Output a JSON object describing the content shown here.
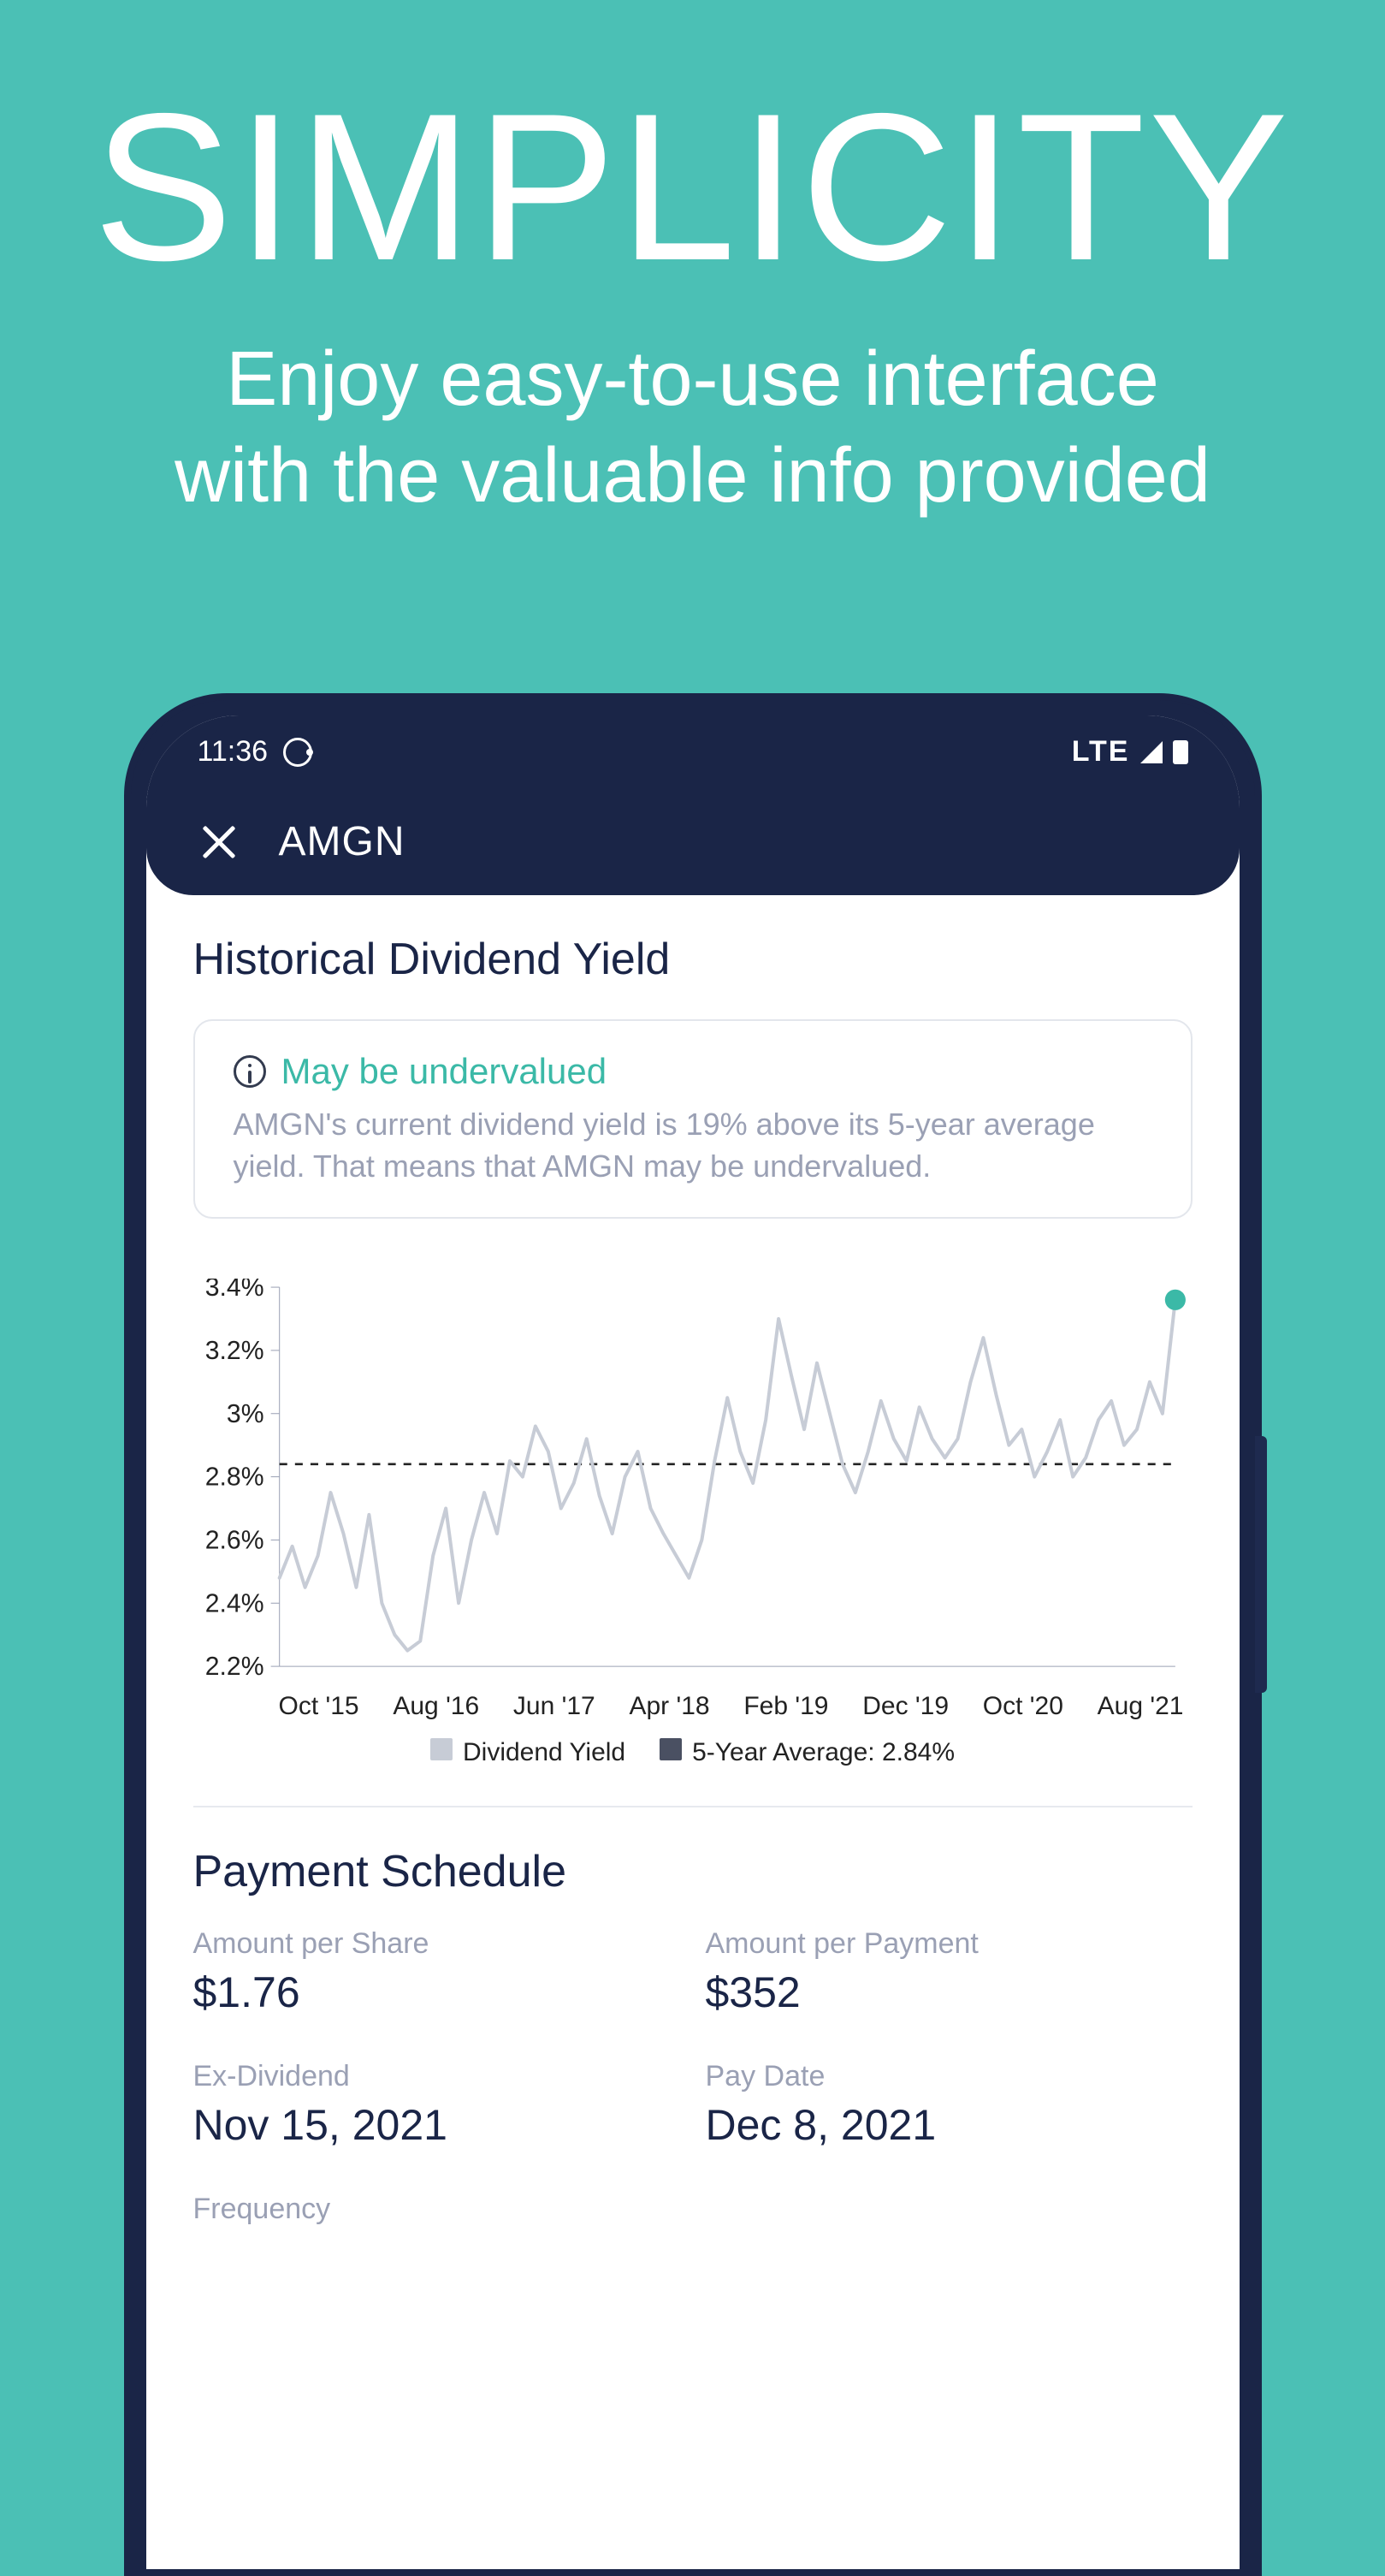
{
  "hero": {
    "title": "SIMPLICITY",
    "subtitle_line1": "Enjoy easy-to-use interface",
    "subtitle_line2": "with the valuable info provided"
  },
  "statusbar": {
    "time": "11:36",
    "net": "LTE"
  },
  "appbar": {
    "ticker": "AMGN"
  },
  "section": {
    "title": "Historical Dividend Yield",
    "info_headline": "May be undervalued",
    "info_body": "AMGN's current dividend yield is 19% above its 5-year average yield. That means that AMGN may be undervalued."
  },
  "legend": {
    "series_label": "Dividend Yield",
    "avg_label": "5-Year Average: 2.84%"
  },
  "payment": {
    "heading": "Payment Schedule",
    "items": [
      {
        "label": "Amount per Share",
        "value": "$1.76"
      },
      {
        "label": "Amount per Payment",
        "value": "$352"
      },
      {
        "label": "Ex-Dividend",
        "value": "Nov 15, 2021"
      },
      {
        "label": "Pay Date",
        "value": "Dec 8, 2021"
      },
      {
        "label": "Frequency",
        "value": ""
      }
    ]
  },
  "chart_data": {
    "type": "line",
    "title": "Historical Dividend Yield",
    "ylabel": "",
    "ylim": [
      2.2,
      3.4
    ],
    "yticks": [
      "3.4%",
      "3.2%",
      "3%",
      "2.8%",
      "2.6%",
      "2.4%",
      "2.2%"
    ],
    "xticks": [
      "Oct '15",
      "Aug '16",
      "Jun '17",
      "Apr '18",
      "Feb '19",
      "Dec '19",
      "Oct '20",
      "Aug '21"
    ],
    "average": 2.84,
    "series": [
      {
        "name": "Dividend Yield",
        "x_index": [
          0,
          1,
          2,
          3,
          4,
          5,
          6,
          7,
          8,
          9,
          10,
          11,
          12,
          13,
          14,
          15,
          16,
          17,
          18,
          19,
          20,
          21,
          22,
          23,
          24,
          25,
          26,
          27,
          28,
          29,
          30,
          31,
          32,
          33,
          34,
          35,
          36,
          37,
          38,
          39,
          40,
          41,
          42,
          43,
          44,
          45,
          46,
          47,
          48,
          49,
          50,
          51,
          52,
          53,
          54,
          55,
          56,
          57,
          58,
          59,
          60,
          61,
          62,
          63,
          64,
          65,
          66,
          67,
          68,
          69,
          70
        ],
        "values": [
          2.48,
          2.58,
          2.45,
          2.55,
          2.75,
          2.62,
          2.45,
          2.68,
          2.4,
          2.3,
          2.25,
          2.28,
          2.55,
          2.7,
          2.4,
          2.6,
          2.75,
          2.62,
          2.85,
          2.8,
          2.96,
          2.88,
          2.7,
          2.78,
          2.92,
          2.74,
          2.62,
          2.8,
          2.88,
          2.7,
          2.62,
          2.55,
          2.48,
          2.6,
          2.85,
          3.05,
          2.88,
          2.78,
          2.98,
          3.3,
          3.12,
          2.95,
          3.16,
          3.0,
          2.84,
          2.75,
          2.88,
          3.04,
          2.92,
          2.85,
          3.02,
          2.92,
          2.86,
          2.92,
          3.1,
          3.24,
          3.06,
          2.9,
          2.95,
          2.8,
          2.88,
          2.98,
          2.8,
          2.86,
          2.98,
          3.04,
          2.9,
          2.95,
          3.1,
          3.0,
          3.36
        ]
      }
    ],
    "marker_last": {
      "x_index": 70,
      "value": 3.36,
      "color": "#3bb9a7"
    }
  }
}
